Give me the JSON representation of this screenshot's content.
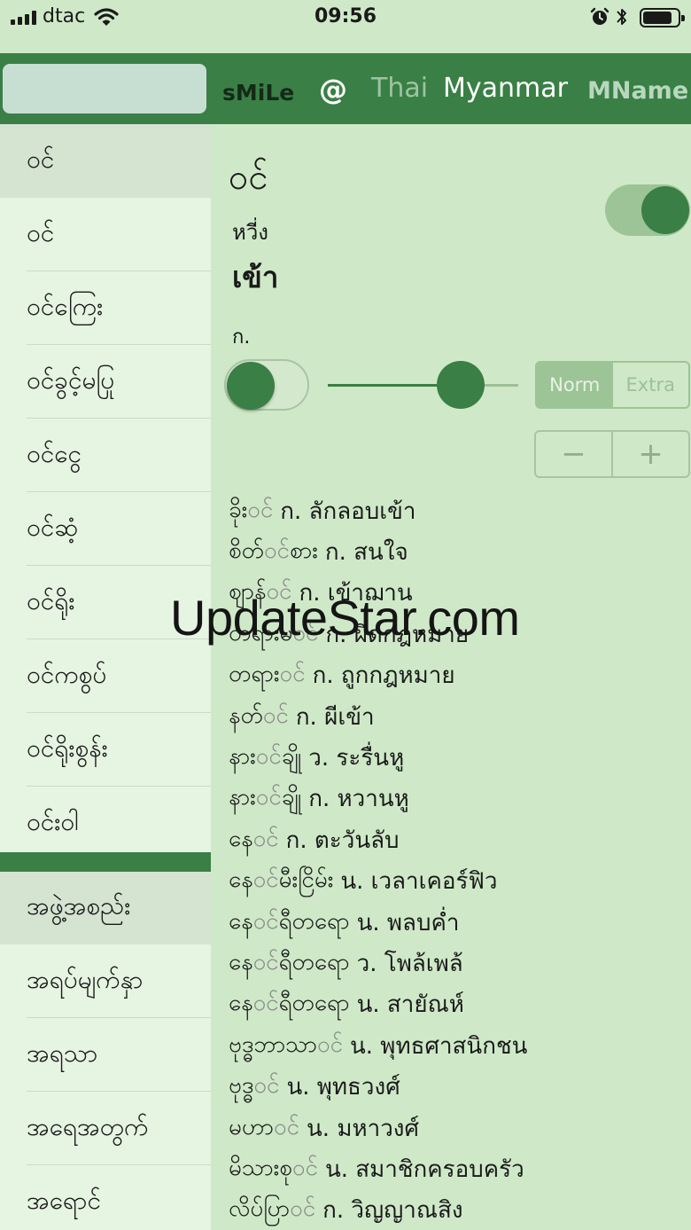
{
  "status_bar": {
    "carrier": "dtac",
    "time": "09:56",
    "battery_level": 0.85,
    "signal_bars": 4
  },
  "header": {
    "search_value": "",
    "nav": [
      "sMiLe",
      "@",
      "Thai",
      "Myanmar",
      "MName"
    ],
    "colors": {
      "bar": "#3a7f45",
      "search": "#c7dfd2"
    }
  },
  "sidebar": {
    "items": [
      "ဝင်",
      "ဝင်",
      "ဝင်ကြေး",
      "ဝင်ခွင့်မပြု",
      "ဝင်ငွေ",
      "ဝင်ဆံ့",
      "ဝင်ရိုး",
      "ဝင်ကစွပ်",
      "ဝင်ရိုးစွန်း",
      "ဝင်းဝါ"
    ],
    "items_b": [
      "အဖွဲ့အစည်း",
      "အရပ်မျက်နှာ",
      "အရသာ",
      "အရေအတွက်",
      "အရောင်"
    ]
  },
  "detail": {
    "headword": "ဝင်",
    "reading": "หวี่ง",
    "translation": "เข้า",
    "pos": "ก.",
    "toggle_top_on": true,
    "toggle_left_on": false,
    "slider_value": 0.6,
    "segments": [
      "Norm",
      "Extra"
    ],
    "selected_segment": "Norm",
    "stepper": [
      "−",
      "+"
    ]
  },
  "entries": [
    {
      "pre": "ခိုး",
      "hl": "ဝင်",
      "post": "",
      "text": "ก. ลักลอบเข้า"
    },
    {
      "pre": "စိတ်",
      "hl": "ဝင်",
      "post": "စား",
      "text": "ก. สนใจ"
    },
    {
      "pre": "ဈာန်",
      "hl": "ဝင်",
      "post": "",
      "text": "ก. เข้าฌาน"
    },
    {
      "pre": "တရားမ",
      "hl": "ဝင်",
      "post": "",
      "text": "ก. ผิดกฎหมาย"
    },
    {
      "pre": "တရား",
      "hl": "ဝင်",
      "post": "",
      "text": "ก. ถูกกฎหมาย"
    },
    {
      "pre": "နတ်",
      "hl": "ဝင်",
      "post": "",
      "text": "ก. ผีเข้า"
    },
    {
      "pre": "နား",
      "hl": "ဝင်",
      "post": "ချို",
      "text": "ว. ระรื่นหู"
    },
    {
      "pre": "နား",
      "hl": "ဝင်",
      "post": "ချို",
      "text": "ก. หวานหู"
    },
    {
      "pre": "နေ",
      "hl": "ဝင်",
      "post": "",
      "text": "ก. ตะวันลับ"
    },
    {
      "pre": "နေ",
      "hl": "ဝင်",
      "post": "မီးငြိမ်း",
      "text": "น. เวลาเคอร์ฟิว"
    },
    {
      "pre": "နေ",
      "hl": "ဝင်",
      "post": "ရီတရော",
      "text": "น. พลบค่ำ"
    },
    {
      "pre": "နေ",
      "hl": "ဝင်",
      "post": "ရီတရော",
      "text": "ว. โพล้เพล้"
    },
    {
      "pre": "နေ",
      "hl": "ဝင်",
      "post": "ရီတရော",
      "text": "น. สายัณห์"
    },
    {
      "pre": "ဗုဒ္ဓဘာသာ",
      "hl": "ဝင်",
      "post": "",
      "text": "น. พุทธศาสนิกชน"
    },
    {
      "pre": "ဗုဒ္ဓ",
      "hl": "ဝင်",
      "post": "",
      "text": "น. พุทธวงศ์"
    },
    {
      "pre": "မဟာ",
      "hl": "ဝင်",
      "post": "",
      "text": "น. มหาวงศ์"
    },
    {
      "pre": "မိသားစု",
      "hl": "ဝင်",
      "post": "",
      "text": "น. สมาชิกครอบครัว"
    },
    {
      "pre": "လိပ်ပြာ",
      "hl": "ဝင်",
      "post": "",
      "text": "ก. วิญญาณสิง"
    }
  ],
  "watermark": "UpdateStar.com"
}
